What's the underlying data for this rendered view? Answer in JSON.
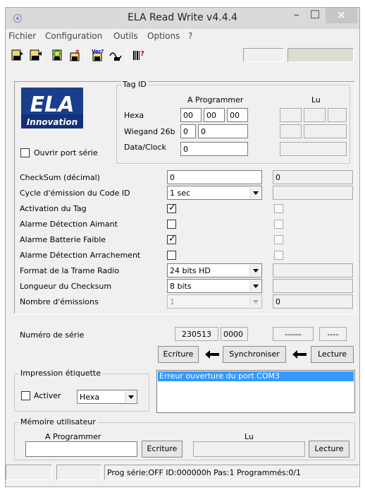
{
  "window": {
    "title": "ELA Read Write v4.4.4"
  },
  "menu": [
    "Fichier",
    "Configuration",
    "Outils",
    "Options",
    "?"
  ],
  "toolbar": {
    "status_field_1": "",
    "status_field_2": ""
  },
  "logo": {
    "line1": "ELA",
    "line2": "Innovation"
  },
  "open_port": {
    "label": "Ouvrir port série"
  },
  "tag_id": {
    "title": "Tag ID",
    "col_prog": "A Programmer",
    "col_read": "Lu",
    "hexa_label": "Hexa",
    "hexa": [
      "00",
      "00",
      "00"
    ],
    "wiegand_label": "Wiegand 26b",
    "wiegand": [
      "0",
      "0"
    ],
    "dataclock_label": "Data/Clock",
    "dataclock": "0"
  },
  "params": {
    "checksum_label": "CheckSum (décimal)",
    "checksum_prog": "0",
    "checksum_read": "0",
    "cycle_label": "Cycle d'émission du Code ID",
    "cycle_value": "1 sec",
    "activation_label": "Activation du Tag",
    "alarm_magnet_label": "Alarme Détection Aimant",
    "alarm_battery_label": "Alarme Batterie Faible",
    "alarm_tamper_label": "Alarme Détection Arrachement",
    "format_label": "Format de la Trame Radio",
    "format_value": "24 bits HD",
    "checksum_len_label": "Longueur du Checksum",
    "checksum_len_value": "8 bits",
    "emissions_label": "Nombre d'émissions",
    "emissions_value": "1",
    "emissions_read": "0"
  },
  "serial": {
    "label": "Numéro de série",
    "prog1": "230513",
    "prog2": "0000",
    "read1": "------",
    "read2": "----"
  },
  "actions": {
    "write": "Ecriture",
    "sync": "Synchroniser",
    "read": "Lecture"
  },
  "print_label": {
    "title": "Impression étiquette",
    "activate": "Activer",
    "format": "Hexa"
  },
  "log": {
    "message": "Erreur ouverture du port COM3"
  },
  "user_memory": {
    "title": "Mémoire utilisateur",
    "col_prog": "A Programmer",
    "col_read": "Lu",
    "prog_value": "",
    "read_value": "",
    "write": "Ecriture",
    "read": "Lecture"
  },
  "statusbar": {
    "pane1": "",
    "pane2": "",
    "text": "Prog série:OFF  ID:000000h  Pas:1  Programmés:0/1"
  }
}
